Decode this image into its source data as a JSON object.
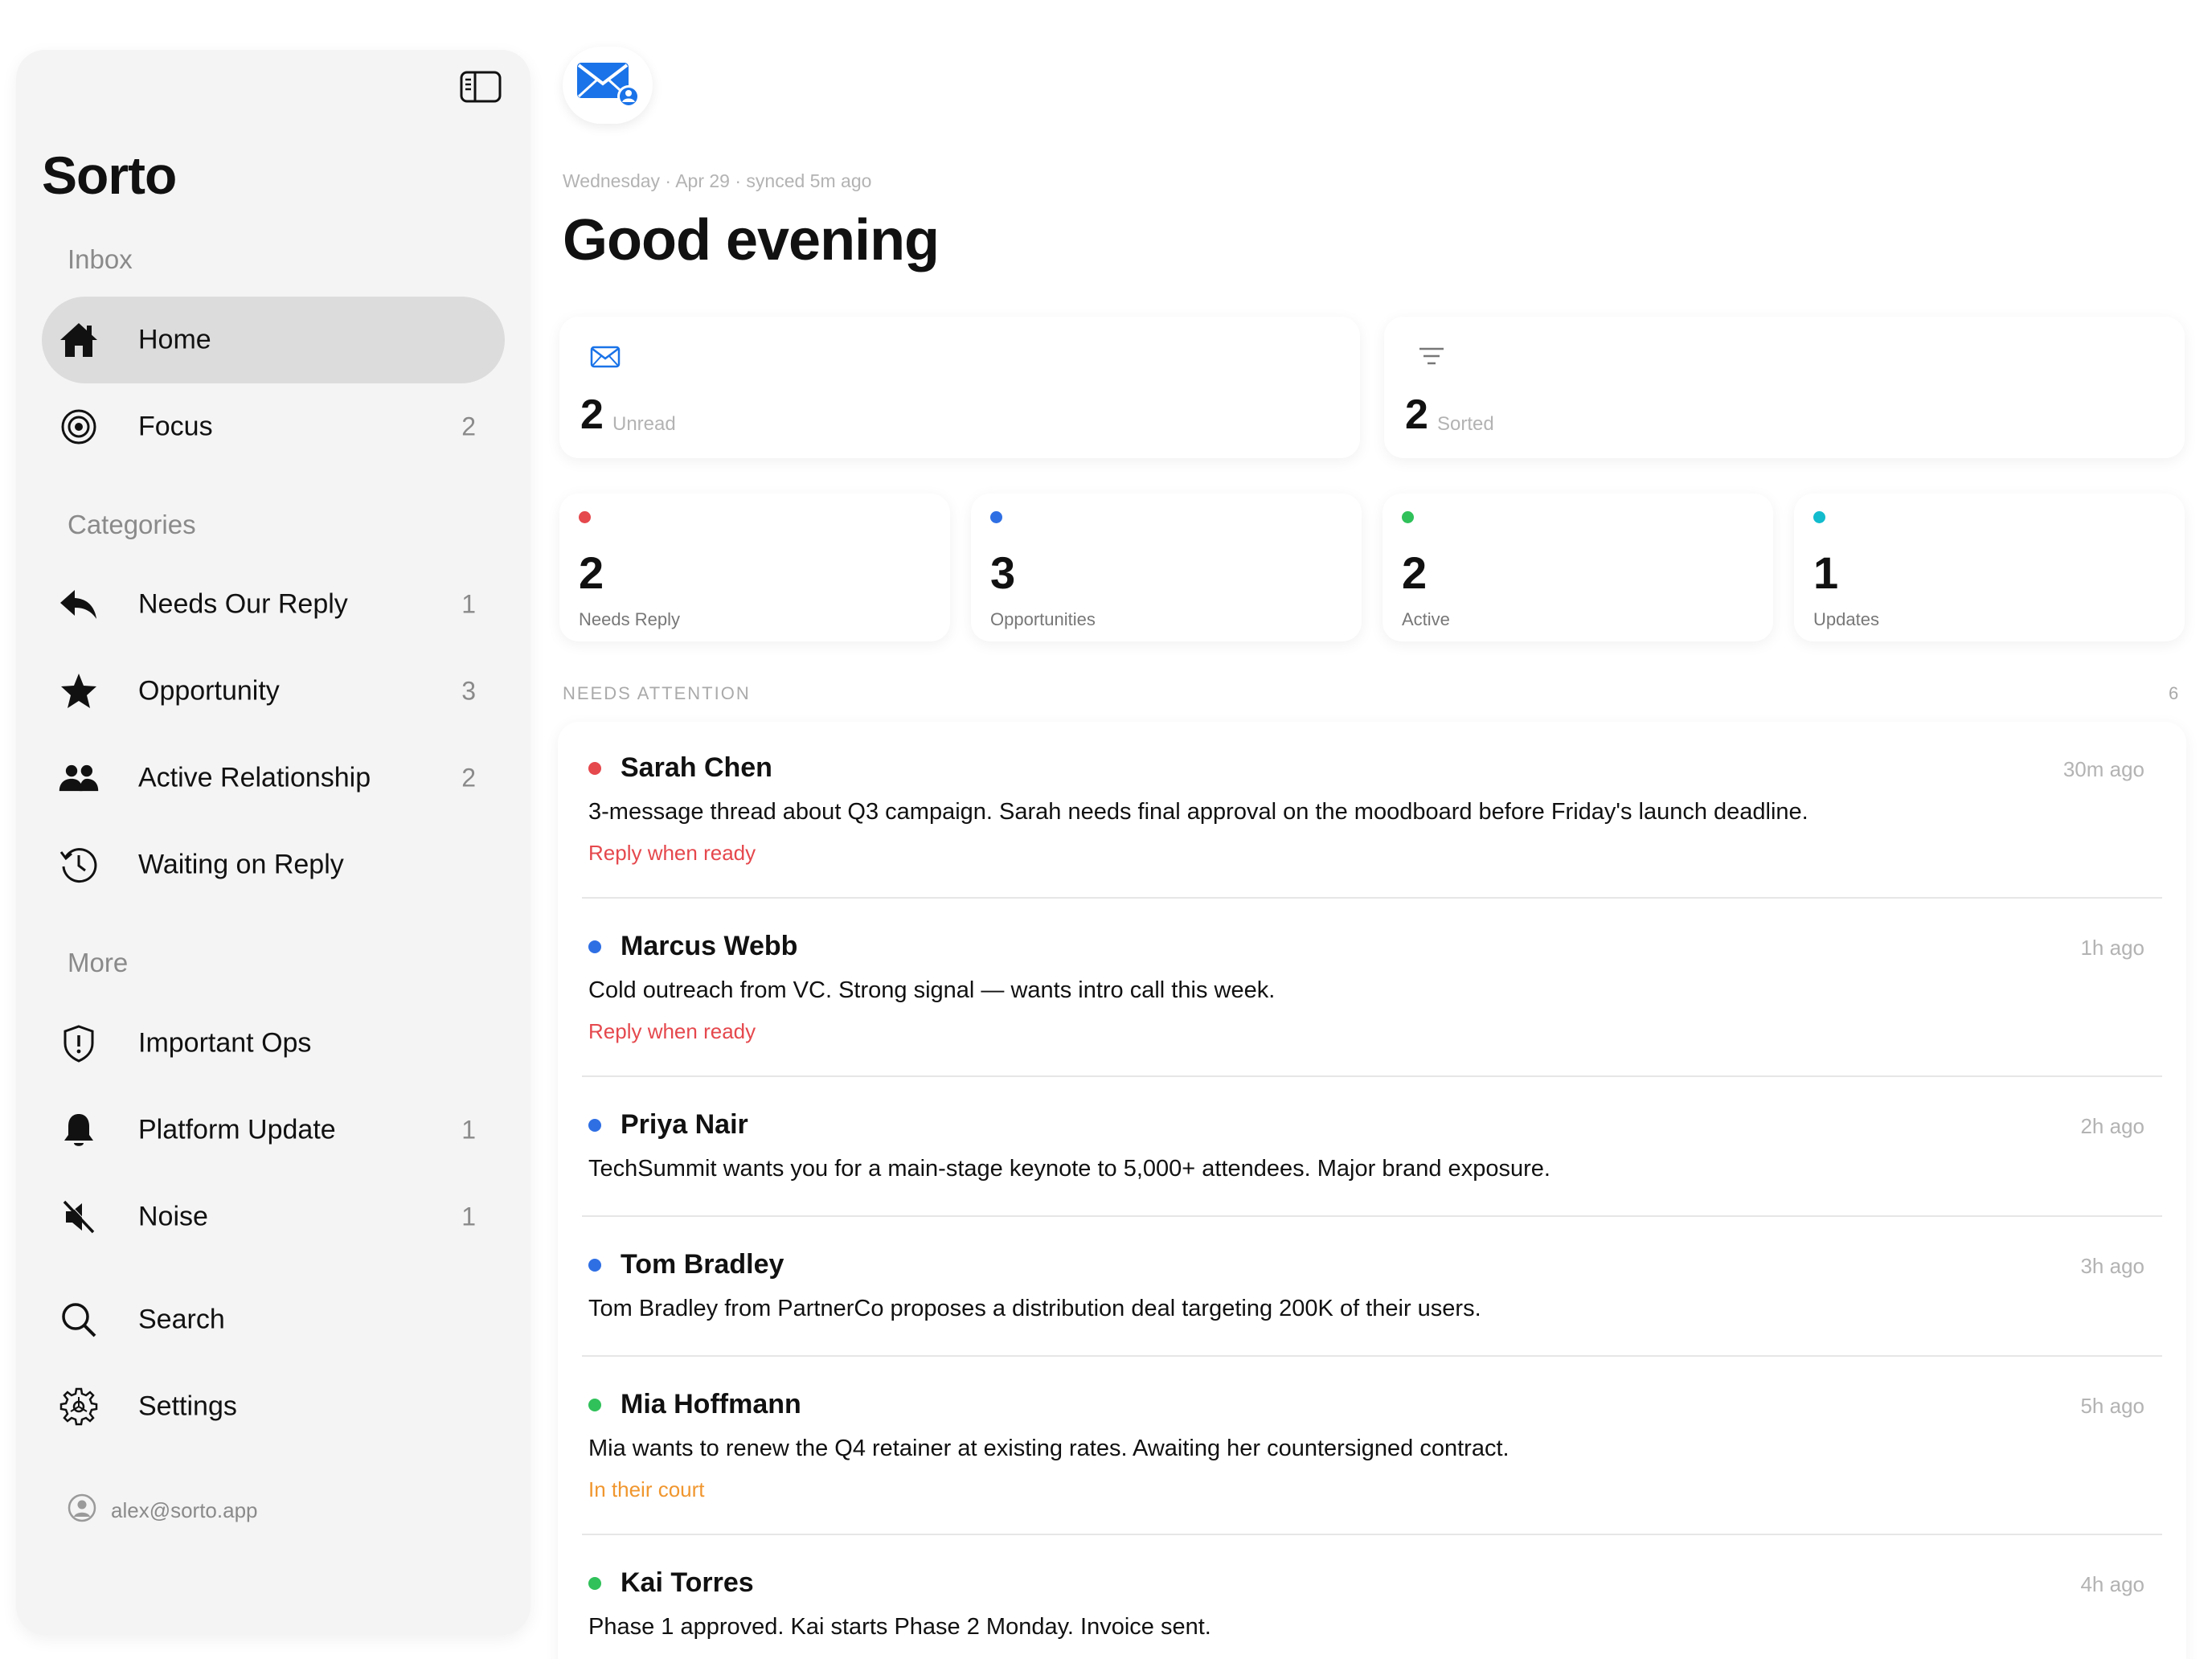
{
  "app": {
    "title": "Sorto"
  },
  "sidebar": {
    "sections": {
      "inbox": "Inbox",
      "categories": "Categories",
      "more": "More"
    },
    "inbox_items": [
      {
        "label": "Home",
        "count": "",
        "icon": "home-icon",
        "active": true
      },
      {
        "label": "Focus",
        "count": "2",
        "icon": "target-icon"
      }
    ],
    "category_items": [
      {
        "label": "Needs Our Reply",
        "count": "1",
        "icon": "reply-icon"
      },
      {
        "label": "Opportunity",
        "count": "3",
        "icon": "star-icon"
      },
      {
        "label": "Active Relationship",
        "count": "2",
        "icon": "people-icon"
      },
      {
        "label": "Waiting on Reply",
        "count": "",
        "icon": "history-icon"
      }
    ],
    "more_items": [
      {
        "label": "Important Ops",
        "count": "",
        "icon": "shield-icon"
      },
      {
        "label": "Platform Update",
        "count": "1",
        "icon": "bell-icon"
      },
      {
        "label": "Noise",
        "count": "1",
        "icon": "muted-speaker-icon"
      }
    ],
    "utility_items": [
      {
        "label": "Search",
        "icon": "search-icon"
      },
      {
        "label": "Settings",
        "icon": "gear-icon"
      }
    ],
    "account": "alex@sorto.app"
  },
  "header": {
    "date_line": "Wednesday · Apr 29 · synced 5m ago",
    "greeting": "Good evening"
  },
  "summary": {
    "unread": {
      "value": "2",
      "label": "Unread"
    },
    "sorted": {
      "value": "2",
      "label": "Sorted"
    }
  },
  "stats": [
    {
      "value": "2",
      "label": "Needs Reply",
      "color": "#e5484d"
    },
    {
      "value": "3",
      "label": "Opportunities",
      "color": "#2f6fe4"
    },
    {
      "value": "2",
      "label": "Active",
      "color": "#30c15a"
    },
    {
      "value": "1",
      "label": "Updates",
      "color": "#12bccd"
    }
  ],
  "attention": {
    "label": "NEEDS ATTENTION",
    "count": "6",
    "messages": [
      {
        "name": "Sarah Chen",
        "time": "30m ago",
        "body": "3-message thread about Q3 campaign. Sarah needs final approval on the moodboard before Friday's launch deadline.",
        "action": "Reply when ready",
        "action_color": "#e5484d",
        "dot_color": "#e5484d"
      },
      {
        "name": "Marcus Webb",
        "time": "1h ago",
        "body": "Cold outreach from VC. Strong signal — wants intro call this week.",
        "action": "Reply when ready",
        "action_color": "#e5484d",
        "dot_color": "#2f6fe4"
      },
      {
        "name": "Priya Nair",
        "time": "2h ago",
        "body": "TechSummit wants you for a main-stage keynote to 5,000+ attendees. Major brand exposure.",
        "action": "",
        "dot_color": "#2f6fe4"
      },
      {
        "name": "Tom Bradley",
        "time": "3h ago",
        "body": "Tom Bradley from PartnerCo proposes a distribution deal targeting 200K of their users.",
        "action": "",
        "dot_color": "#2f6fe4"
      },
      {
        "name": "Mia Hoffmann",
        "time": "5h ago",
        "body": "Mia wants to renew the Q4 retainer at existing rates. Awaiting her countersigned contract.",
        "action": "In their court",
        "action_color": "#f0962e",
        "dot_color": "#30c15a"
      },
      {
        "name": "Kai Torres",
        "time": "4h ago",
        "body": "Phase 1 approved. Kai starts Phase 2 Monday. Invoice sent.",
        "action": "",
        "dot_color": "#30c15a"
      }
    ]
  },
  "colors": {
    "accent": "#1a73e8",
    "sidebar_bg": "#f4f4f4",
    "active_item_bg": "#dcdcdc"
  }
}
